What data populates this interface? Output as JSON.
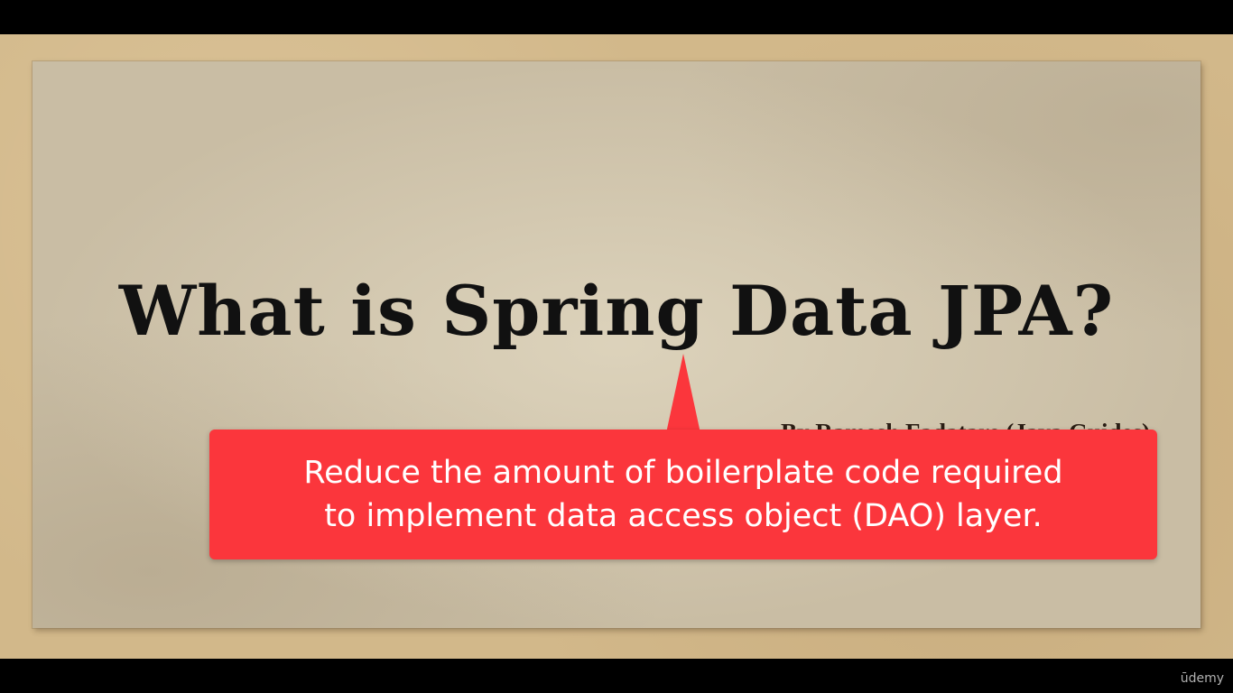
{
  "slide": {
    "title": "What is Spring Data JPA?",
    "byline": "By Ramesh Fadatare (Java Guides)"
  },
  "callout": {
    "line1": "Reduce the amount of boilerplate code required",
    "line2": "to implement data access object (DAO) layer.",
    "color": "#fb363c"
  },
  "branding": {
    "watermark": "ūdemy"
  }
}
